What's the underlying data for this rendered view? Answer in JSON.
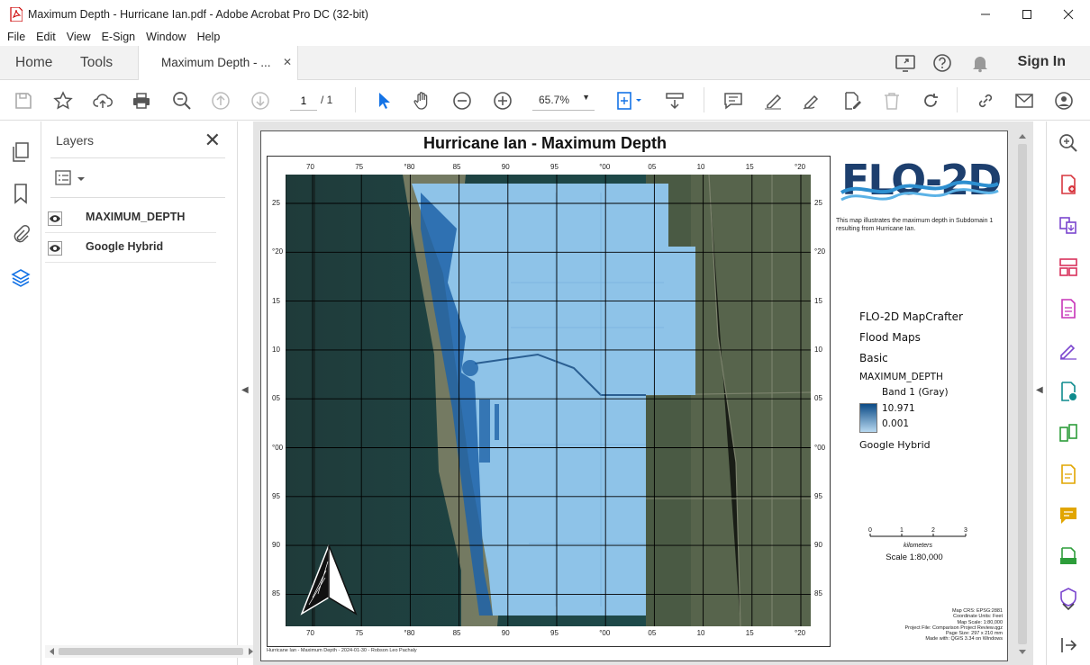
{
  "window": {
    "title": "Maximum Depth - Hurricane Ian.pdf - Adobe Acrobat Pro DC (32-bit)"
  },
  "menu": [
    "File",
    "Edit",
    "View",
    "E-Sign",
    "Window",
    "Help"
  ],
  "tabs": {
    "home": "Home",
    "tools": "Tools",
    "document": "Maximum Depth - ...",
    "signin": "Sign In"
  },
  "toolbar": {
    "page_current": "1",
    "page_total": "/ 1",
    "zoom": "65.7%"
  },
  "layers_panel": {
    "title": "Layers",
    "items": [
      {
        "label": "MAXIMUM_DEPTH"
      },
      {
        "label": "Google Hybrid"
      }
    ]
  },
  "map": {
    "title": "Hurricane Ian - Maximum Depth",
    "top_ticks": [
      "70",
      "75",
      "°80",
      "85",
      "90",
      "95",
      "°00",
      "05",
      "10",
      "15",
      "°20"
    ],
    "left_ticks": [
      "25",
      "°20",
      "15",
      "10",
      "05",
      "°00",
      "95",
      "90",
      "85"
    ],
    "credit": "Hurricane Ian - Maximum Depth - 2024-01-30 - Robson Leo Pachaly",
    "logo_text": "FLO-2D",
    "description": "This map illustrates the maximum depth in Subdomain 1 resulting from Hurricane Ian.",
    "legend": {
      "line1": "FLO-2D MapCrafter",
      "line2": "Flood Maps",
      "line3": "Basic",
      "layer": "MAXIMUM_DEPTH",
      "band": "Band 1 (Gray)",
      "max": "10.971",
      "min": "0.001",
      "basemap": "Google Hybrid"
    },
    "scale": {
      "ticks": [
        "0",
        "1",
        "2",
        "3"
      ],
      "unit": "kilometers",
      "label": "Scale 1:80,000"
    },
    "metadata": [
      "Map CRS: EPSG:2881",
      "Coordinate Units: Feet",
      "Map Scale: 1:80,000",
      "Project File: Comparison Project Review.qgz",
      "Page Size: 297 x 210 mm",
      "Made with: QGIS 3.34 on Windows"
    ]
  }
}
